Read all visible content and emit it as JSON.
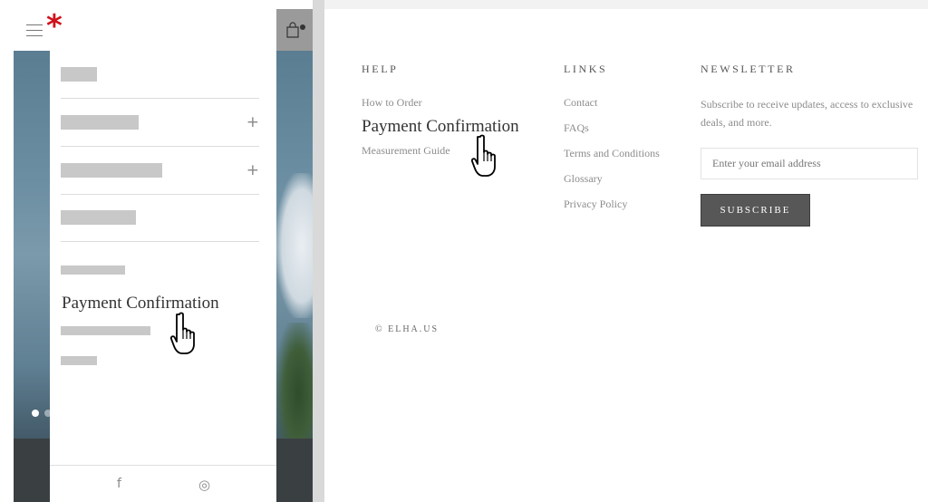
{
  "mobile": {
    "brand_mark": "*",
    "drawer": {
      "expand_symbol": "+",
      "highlighted_item": "Payment Confirmation",
      "social": [
        {
          "name": "facebook",
          "glyph": "f"
        },
        {
          "name": "instagram",
          "glyph": "◎"
        }
      ]
    }
  },
  "footer": {
    "help": {
      "heading": "HELP",
      "links": [
        "How to Order",
        "Payment Confirmation",
        "Measurement Guide"
      ]
    },
    "links": {
      "heading": "LINKS",
      "links": [
        "Contact",
        "FAQs",
        "Terms and Conditions",
        "Glossary",
        "Privacy Policy"
      ]
    },
    "newsletter": {
      "heading": "NEWSLETTER",
      "text": "Subscribe to receive updates, access to exclusive deals, and more.",
      "email_placeholder": "Enter your email address",
      "button": "SUBSCRIBE"
    },
    "copyright": "© ELHA.US"
  },
  "colors": {
    "brand_red": "#d0121b",
    "button_bg": "#575757"
  },
  "icons": [
    "hamburger-icon",
    "bag-icon",
    "plus-icon",
    "facebook-icon",
    "instagram-icon",
    "hand-pointer-cursor-icon"
  ]
}
